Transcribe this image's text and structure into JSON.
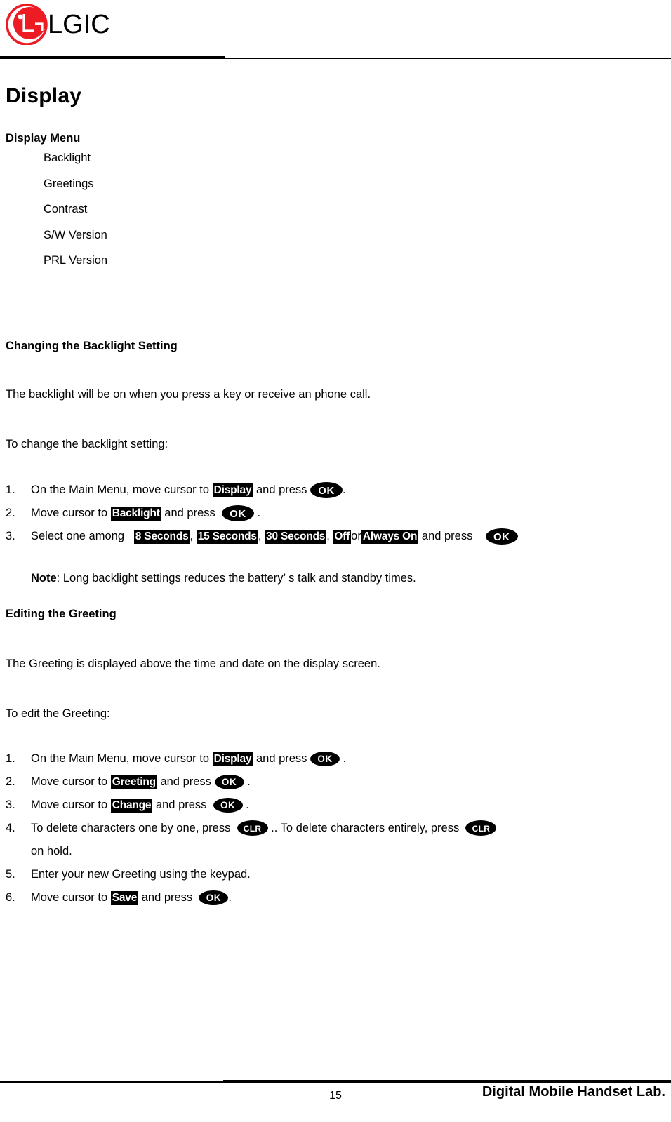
{
  "header": {
    "logo_text": "LGIC",
    "logo_color": "#ED1C24"
  },
  "page_title": "Display",
  "display_menu": {
    "label": "Display Menu",
    "items": [
      "Backlight",
      "Greetings",
      "Contrast",
      "S/W Version",
      "PRL Version"
    ]
  },
  "section_backlight": {
    "heading": "Changing the Backlight Setting",
    "intro": "The backlight will be on when you press a key or receive an phone call.",
    "lead_in": "To change the backlight setting:",
    "steps": [
      {
        "num": "1.",
        "before": "On the Main Menu, move cursor to",
        "highlight": "Display",
        "middle": "and press",
        "key": "OK",
        "after": "."
      },
      {
        "num": "2.",
        "before": "Move cursor to",
        "highlight": "Backlight",
        "middle": "and press",
        "key": "OK",
        "after": "."
      },
      {
        "num": "3.",
        "before": "Select one among",
        "options": [
          "8 Seconds",
          "15 Seconds",
          "30 Seconds",
          "Off",
          "Always On"
        ],
        "separator": ",",
        "or_word": "or",
        "middle": "and press",
        "key": "OK",
        "after": ""
      }
    ],
    "note_label": "Note",
    "note_text": ": Long backlight settings reduces the battery’ s talk and standby times."
  },
  "section_greeting": {
    "heading": "Editing the Greeting",
    "intro": "The Greeting is displayed above the time and date on the display screen.",
    "lead_in": "To edit the Greeting:",
    "steps": [
      {
        "num": "1.",
        "before": "On the Main Menu, move cursor to",
        "highlight": "Display",
        "middle": "and press",
        "key": "OK",
        "after": "."
      },
      {
        "num": "2.",
        "before": "Move cursor to",
        "highlight": "Greeting",
        "middle": "and press",
        "key": "OK",
        "after": "."
      },
      {
        "num": "3.",
        "before": "Move cursor to",
        "highlight": "Change",
        "middle": "and press",
        "key": "OK",
        "after": "."
      },
      {
        "num": "4.",
        "before": "To delete characters one by one, press",
        "key1": "CLR",
        "middle": ".. To delete characters entirely, press",
        "key2": "CLR",
        "after": "",
        "continuation": "on hold."
      },
      {
        "num": "5.",
        "text": "Enter your new Greeting using the keypad."
      },
      {
        "num": "6.",
        "before": "Move cursor to",
        "highlight": "Save",
        "middle": "and press",
        "key": "OK",
        "after": "."
      }
    ]
  },
  "footer": {
    "page_number": "15",
    "brand": "Digital Mobile Handset Lab."
  }
}
